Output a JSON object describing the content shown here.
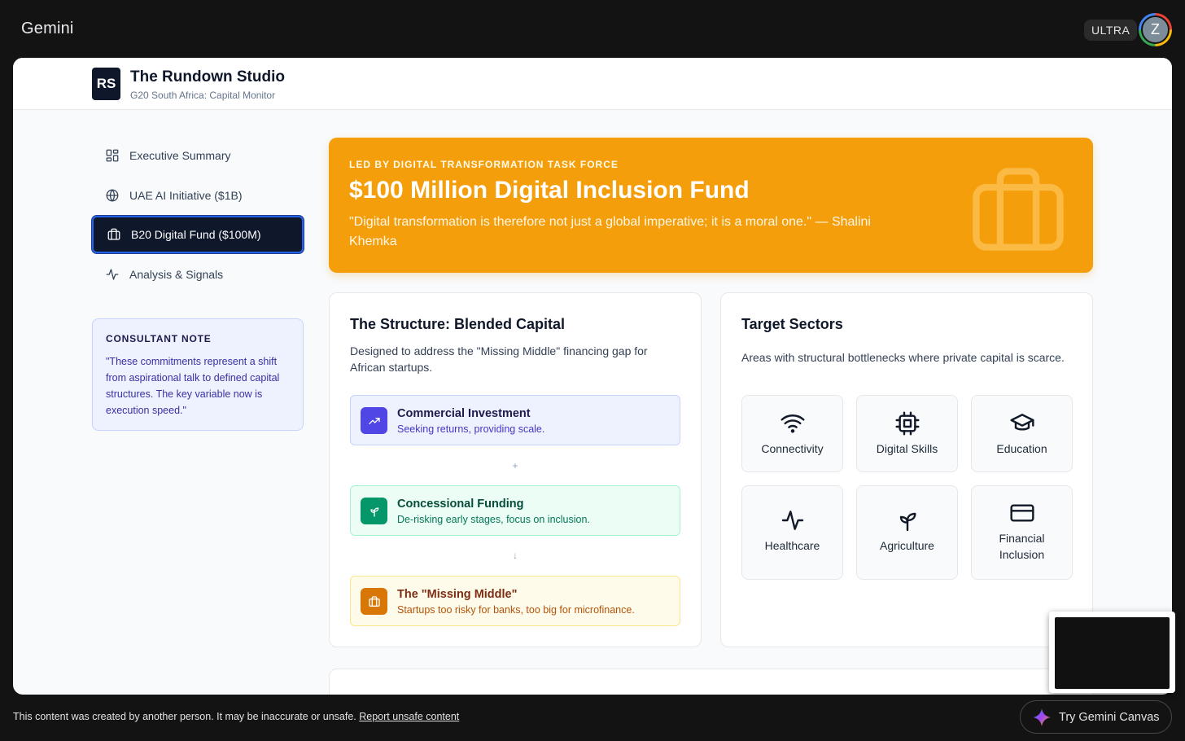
{
  "gemini": {
    "brand": "Gemini",
    "plan_badge": "ULTRA",
    "avatar_initial": "Z"
  },
  "app": {
    "logo": "RS",
    "title": "The Rundown Studio",
    "subtitle": "G20 South Africa: Capital Monitor"
  },
  "sidebar": {
    "items": [
      {
        "label": "Executive Summary",
        "icon": "grid-icon",
        "active": false
      },
      {
        "label": "UAE AI Initiative ($1B)",
        "icon": "globe-icon",
        "active": false
      },
      {
        "label": "B20 Digital Fund ($100M)",
        "icon": "briefcase-icon",
        "active": true
      },
      {
        "label": "Analysis & Signals",
        "icon": "activity-icon",
        "active": false
      }
    ],
    "note": {
      "title": "CONSULTANT NOTE",
      "body": "\"These commitments represent a shift from aspirational talk to defined capital structures. The key variable now is execution speed.\""
    }
  },
  "hero": {
    "kicker": "LED BY DIGITAL TRANSFORMATION TASK FORCE",
    "title": "$100 Million Digital Inclusion Fund",
    "quote": "\"Digital transformation is therefore not just a global imperative; it is a moral one.\" — Shalini Khemka",
    "icon": "briefcase-icon",
    "color": "#f59e0b"
  },
  "structure": {
    "title": "The Structure: Blended Capital",
    "description": "Designed to address the \"Missing Middle\" financing gap for African startups.",
    "steps": [
      {
        "title": "Commercial Investment",
        "description": "Seeking returns, providing scale.",
        "icon": "trending-up-icon",
        "color": "#4f46e5"
      },
      {
        "title": "Concessional Funding",
        "description": "De-risking early stages, focus on inclusion.",
        "icon": "sprout-icon",
        "color": "#059669"
      },
      {
        "title": "The \"Missing Middle\"",
        "description": "Startups too risky for banks, too big for microfinance.",
        "icon": "briefcase-icon",
        "color": "#d97706"
      }
    ],
    "connectors": [
      "+",
      "↓"
    ]
  },
  "sectors": {
    "title": "Target Sectors",
    "description": "Areas with structural bottlenecks where private capital is scarce.",
    "items": [
      {
        "label": "Connectivity",
        "icon": "wifi-icon"
      },
      {
        "label": "Digital Skills",
        "icon": "cpu-icon"
      },
      {
        "label": "Education",
        "icon": "graduation-cap-icon"
      },
      {
        "label": "Healthcare",
        "icon": "activity-icon"
      },
      {
        "label": "Agriculture",
        "icon": "sprout-icon"
      },
      {
        "label": "Financial Inclusion",
        "icon": "credit-card-icon"
      }
    ]
  },
  "footer": {
    "disclaimer": "This content was created by another person. It may be inaccurate or unsafe.",
    "report_link": "Report unsafe content",
    "canvas_button": "Try Gemini Canvas"
  }
}
